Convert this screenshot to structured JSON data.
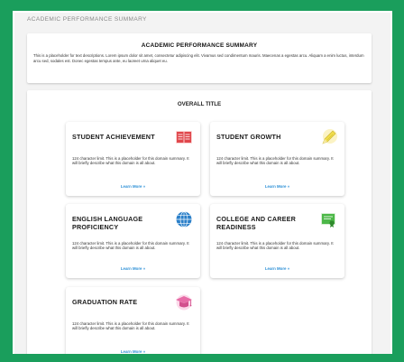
{
  "breadcrumb": "ACADEMIC PERFORMANCE SUMMARY",
  "summary": {
    "title": "ACADEMIC PERFORMANCE SUMMARY",
    "text": "This is a placeholder for text descriptions. Lorem ipsum dolor sit amet, consectetur adipiscing elit. Vivamus sed condimentum mauris. Maecenas a egestas arcu. Aliquam a enim luctus, interdum arcu sed, sodales est. Donec egestas tempus ante, eu laoreet urna aliquet eu."
  },
  "main": {
    "title": "OVERALL TITLE",
    "cards": [
      {
        "title": "STUDENT ACHIEVEMENT",
        "desc": "124 character limit. This is a placeholder for this domain summary. It will briefly describe what this domain is all about.",
        "link": "Learn More »",
        "icon": "book-icon"
      },
      {
        "title": "STUDENT GROWTH",
        "desc": "124 character limit. This is a placeholder for this domain summary. It will briefly describe what this domain is all about.",
        "link": "Learn More »",
        "icon": "pencil-icon"
      },
      {
        "title": "ENGLISH LANGUAGE PROFICIENCY",
        "desc": "124 character limit. This is a placeholder for this domain summary. It will briefly describe what this domain is all about.",
        "link": "Learn More »",
        "icon": "globe-icon"
      },
      {
        "title": "COLLEGE AND CAREER READINESS",
        "desc": "124 character limit. This is a placeholder for this domain summary. It will briefly describe what this domain is all about.",
        "link": "Learn More »",
        "icon": "certificate-icon"
      },
      {
        "title": "GRADUATION RATE",
        "desc": "124 character limit. This is a placeholder for this domain summary. It will briefly describe what this domain is all about.",
        "link": "Learn More »",
        "icon": "graduation-cap-icon"
      }
    ]
  },
  "colors": {
    "frame": "#1a9e5c",
    "link": "#2b8fd6",
    "book": "#e0474c",
    "pencil": "#f0dc4a",
    "globe": "#2a7fc9",
    "certificate": "#4cb848",
    "cap": "#e76ba6"
  }
}
